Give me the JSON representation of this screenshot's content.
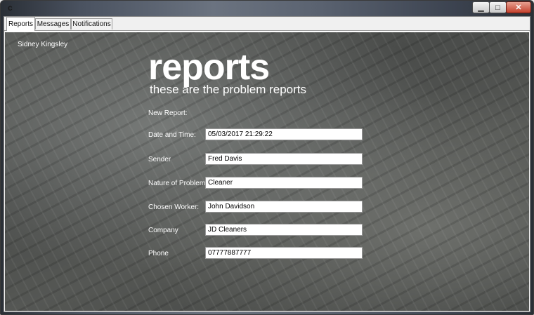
{
  "window": {
    "title": "c",
    "buttons": {
      "minimize": "▁",
      "maximize": "□",
      "close": "✕"
    }
  },
  "tabs": [
    {
      "label": "Reports",
      "active": true
    },
    {
      "label": "Messages",
      "active": false
    },
    {
      "label": "Notifications",
      "active": false
    }
  ],
  "panel": {
    "user_name": "Sidney Kingsley",
    "heading": "reports",
    "subheading": "these are the problem reports",
    "new_report_label": "New Report:",
    "fields": [
      {
        "label": "Date and Time:",
        "value": "05/03/2017 21:29:22"
      },
      {
        "label": "Sender",
        "value": "Fred Davis"
      },
      {
        "label": "Nature of Problem:",
        "value": "Cleaner"
      },
      {
        "label": "Chosen Worker:",
        "value": "John Davidson"
      },
      {
        "label": "Company",
        "value": "JD Cleaners"
      },
      {
        "label": "Phone",
        "value": "07777887777"
      }
    ]
  }
}
